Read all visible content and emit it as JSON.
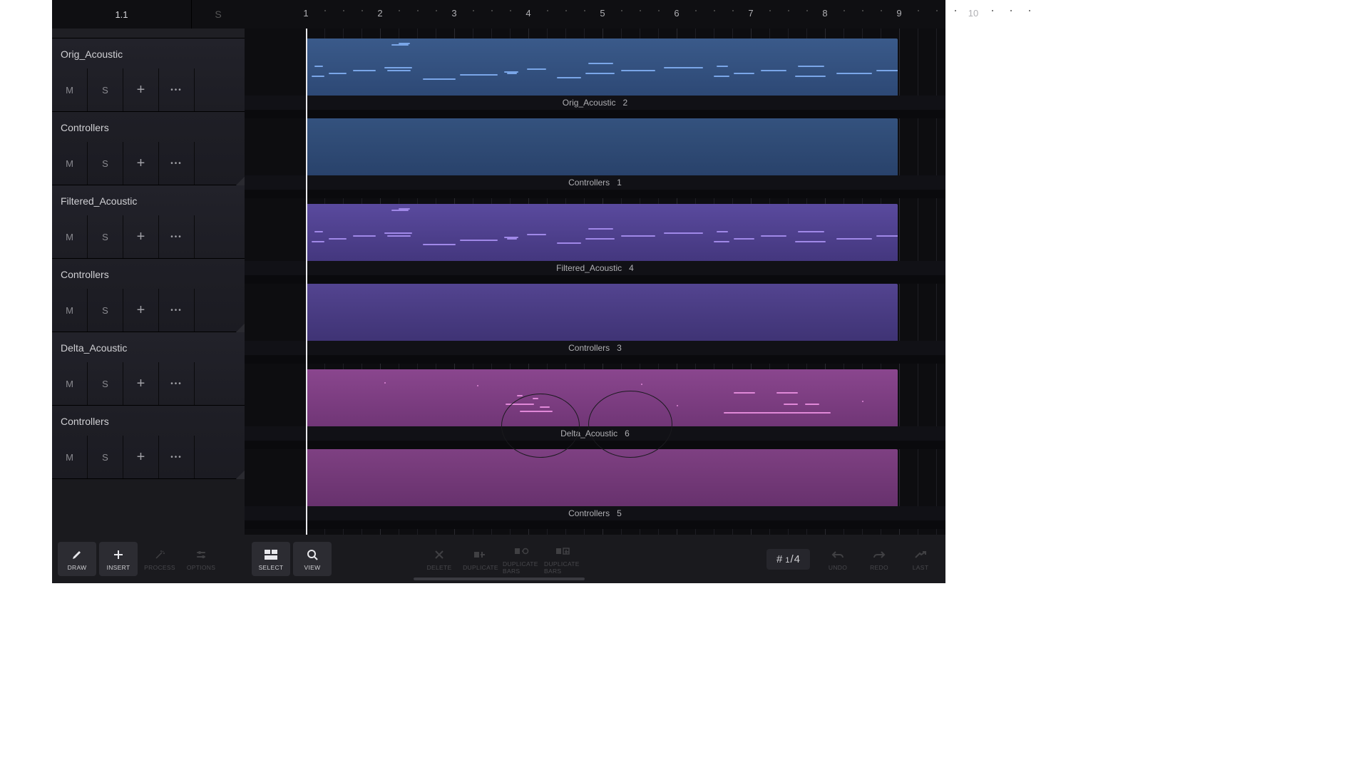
{
  "position": "1.1",
  "position_side": "S",
  "ruler": {
    "start": 1,
    "end": 10,
    "subdivisions": 4
  },
  "tracks": [
    {
      "name": "Orig_Acoustic",
      "clip_label": "Orig_Acoustic",
      "clip_num": "2",
      "controllers_label": "Controllers",
      "ctl_num": "1",
      "hue": "blue"
    },
    {
      "name": "Filtered_Acoustic",
      "clip_label": "Filtered_Acoustic",
      "clip_num": "4",
      "controllers_label": "Controllers",
      "ctl_num": "3",
      "hue": "purp"
    },
    {
      "name": "Delta_Acoustic",
      "clip_label": "Delta_Acoustic",
      "clip_num": "6",
      "controllers_label": "Controllers",
      "ctl_num": "5",
      "hue": "mag"
    }
  ],
  "track_buttons": {
    "mute": "M",
    "solo": "S"
  },
  "toolbar": {
    "draw": "DRAW",
    "insert": "INSERT",
    "process": "PROCESS",
    "options": "OPTIONS",
    "select": "SELECT",
    "view": "VIEW",
    "delete": "DELETE",
    "duplicate": "DUPLICATE",
    "dup_a": "DUPLICATE BARS",
    "dup_b": "DUPLICATE BARS",
    "undo": "UNDO",
    "redo": "REDO",
    "last": "LAST"
  },
  "snap": {
    "symbol": "#",
    "num": "1",
    "den": "4"
  }
}
